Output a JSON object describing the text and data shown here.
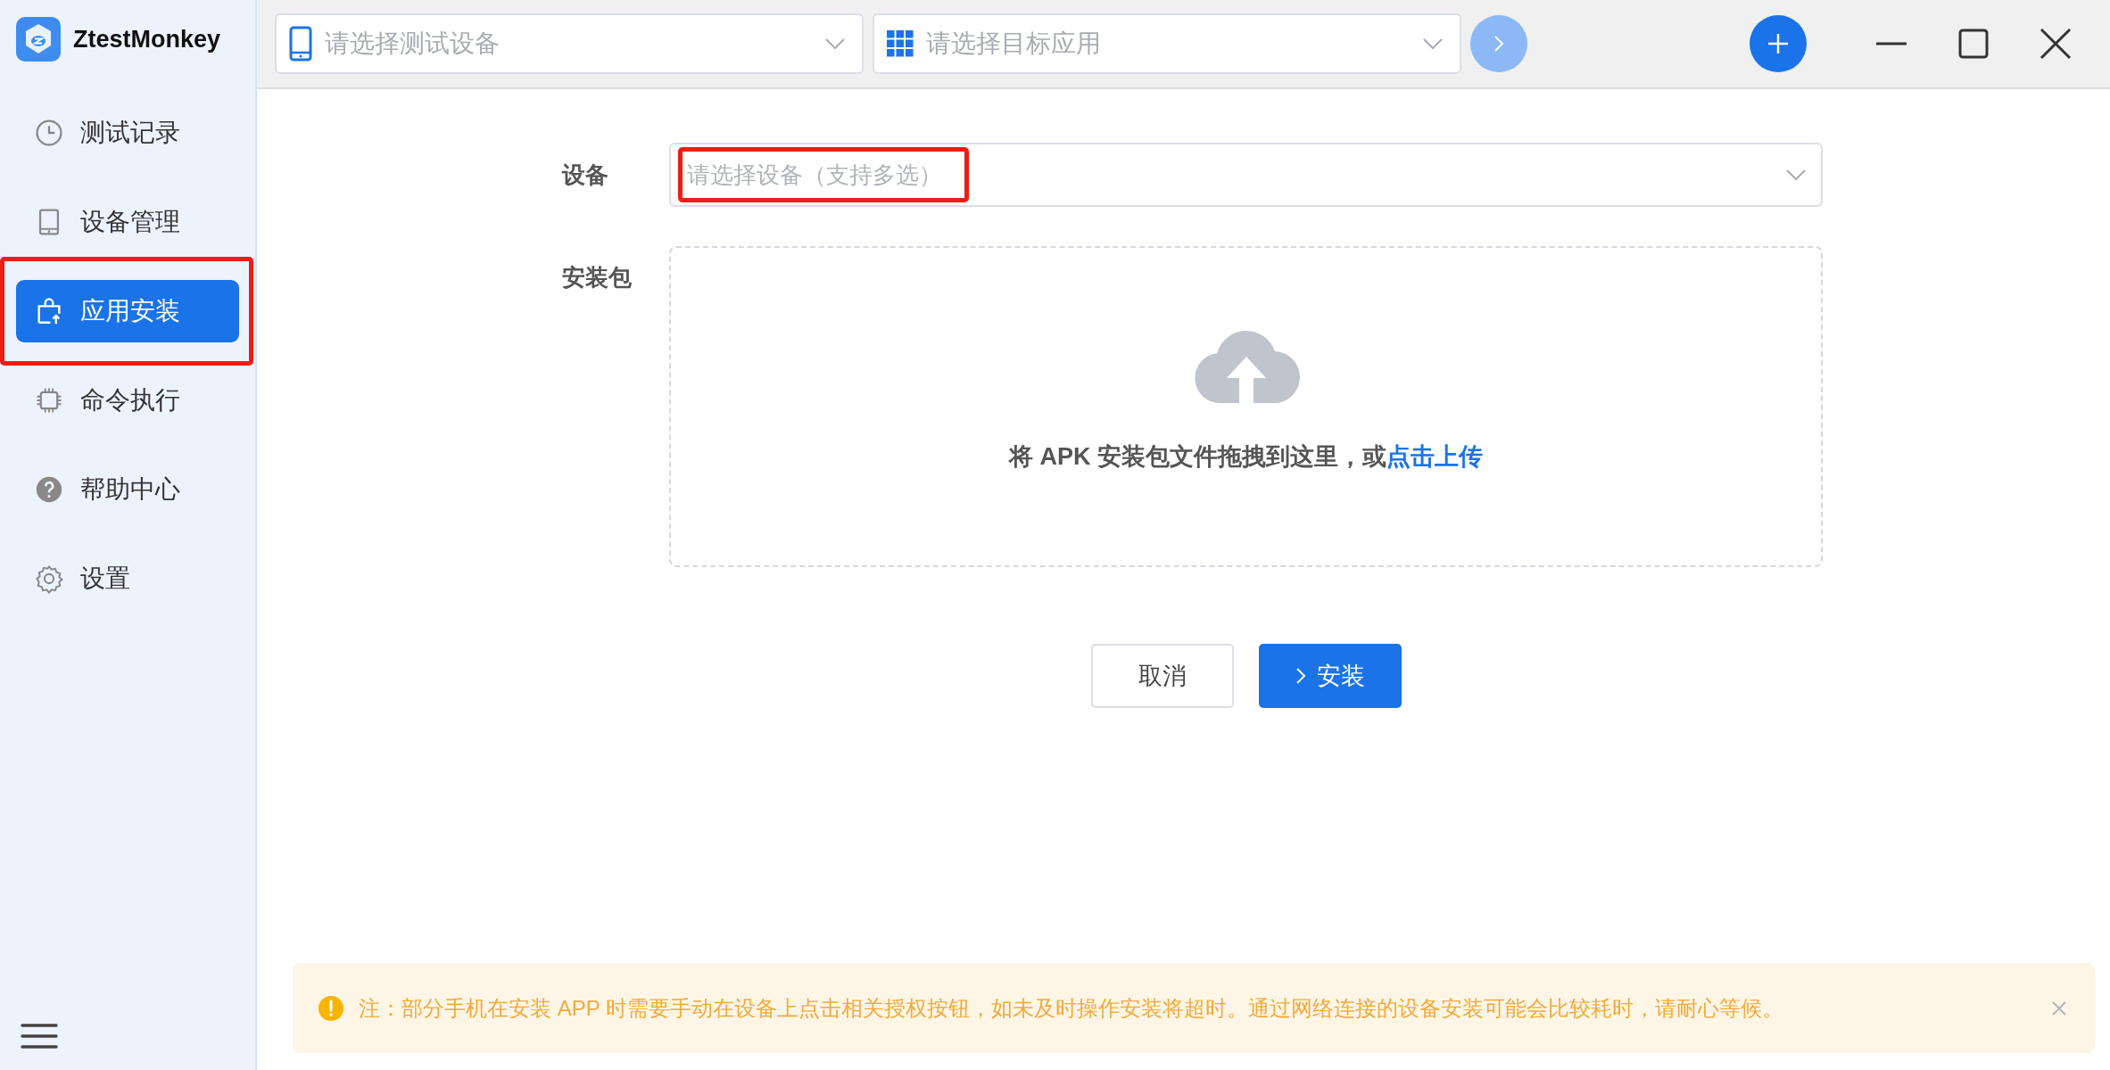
{
  "app": {
    "name": "ZtestMonkey"
  },
  "sidebar": {
    "items": [
      {
        "label": "测试记录",
        "selected": false,
        "highlighted": false
      },
      {
        "label": "设备管理",
        "selected": false,
        "highlighted": false
      },
      {
        "label": "应用安装",
        "selected": true,
        "highlighted": true
      },
      {
        "label": "命令执行",
        "selected": false,
        "highlighted": false
      },
      {
        "label": "帮助中心",
        "selected": false,
        "highlighted": false
      },
      {
        "label": "设置",
        "selected": false,
        "highlighted": false
      }
    ]
  },
  "toolbar": {
    "device_select": {
      "placeholder": "请选择测试设备"
    },
    "app_select": {
      "placeholder": "请选择目标应用"
    },
    "go_button": {
      "disabled": true
    }
  },
  "form": {
    "device": {
      "label": "设备",
      "placeholder": "请选择设备（支持多选）",
      "highlighted": true
    },
    "package": {
      "label": "安装包",
      "hint": "将 APK 安装包文件拖拽到这里，或",
      "link": "点击上传"
    },
    "buttons": {
      "cancel": "取消",
      "install": "安装"
    }
  },
  "notice": {
    "text": "注：部分手机在安装 APP 时需要手动在设备上点击相关授权按钮，如未及时操作安装将超时。通过网络连接的设备安装可能会比较耗时，请耐心等候。"
  }
}
